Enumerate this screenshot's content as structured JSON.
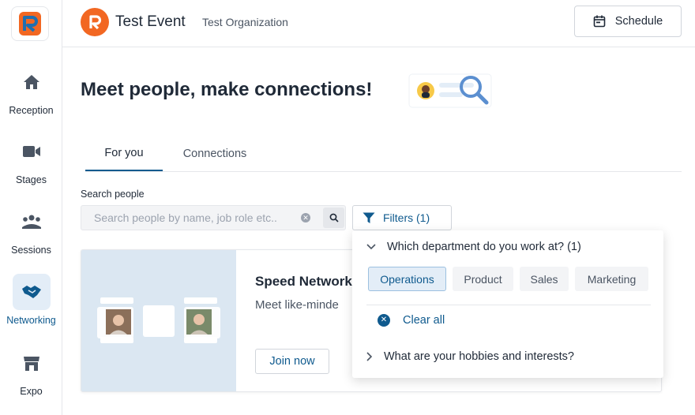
{
  "sidebar": {
    "items": [
      {
        "label": "Reception",
        "icon": "home-icon"
      },
      {
        "label": "Stages",
        "icon": "video-camera-icon"
      },
      {
        "label": "Sessions",
        "icon": "people-group-icon"
      },
      {
        "label": "Networking",
        "icon": "handshake-icon",
        "active": true
      },
      {
        "label": "Expo",
        "icon": "storefront-icon"
      }
    ]
  },
  "header": {
    "event_title": "Test Event",
    "organization": "Test Organization",
    "schedule_label": "Schedule"
  },
  "main": {
    "headline": "Meet people, make connections!",
    "tabs": [
      {
        "label": "For you",
        "active": true
      },
      {
        "label": "Connections",
        "active": false
      }
    ],
    "search": {
      "label": "Search people",
      "placeholder": "Search people by name, job role etc..",
      "value": ""
    },
    "filters_label": "Filters (1)",
    "card": {
      "title": "Speed Network",
      "description": "Meet like-minde",
      "join_label": "Join now"
    }
  },
  "filter_panel": {
    "question1": "Which department do you work at? (1)",
    "options": [
      {
        "label": "Operations",
        "selected": true
      },
      {
        "label": "Product",
        "selected": false
      },
      {
        "label": "Sales",
        "selected": false
      },
      {
        "label": "Marketing",
        "selected": false
      }
    ],
    "clear_all_label": "Clear all",
    "question2": "What are your hobbies and interests?"
  },
  "colors": {
    "accent": "#0f5a8e",
    "brand_orange": "#f26722",
    "active_bg": "#e3edf7"
  }
}
